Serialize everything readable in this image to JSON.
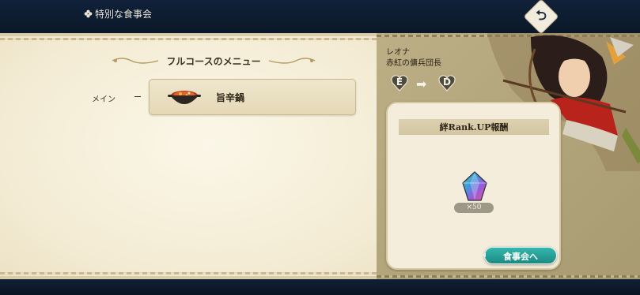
{
  "header": {
    "title": "特別な食事会",
    "title_icon": "clover-icon",
    "back_icon": "return-arrow-icon"
  },
  "menu": {
    "heading": "フルコースのメニュー",
    "rows": [
      {
        "label": "メイン",
        "dish_name": "旨辛鍋",
        "dish_icon": "spicy-hotpot-icon"
      }
    ]
  },
  "character": {
    "name": "レオナ",
    "title": "赤紅の傭兵団長",
    "rank_from": "E",
    "rank_to": "D"
  },
  "reward": {
    "heading": "絆Rank.UP報酬",
    "item_icon": "rainbow-gem-icon",
    "quantity": "×50"
  },
  "actions": {
    "meal_button": "食事会へ"
  },
  "colors": {
    "accent_teal": "#22968c",
    "panel_cream": "#f5efdc",
    "panel_taupe": "#b4a67c"
  }
}
